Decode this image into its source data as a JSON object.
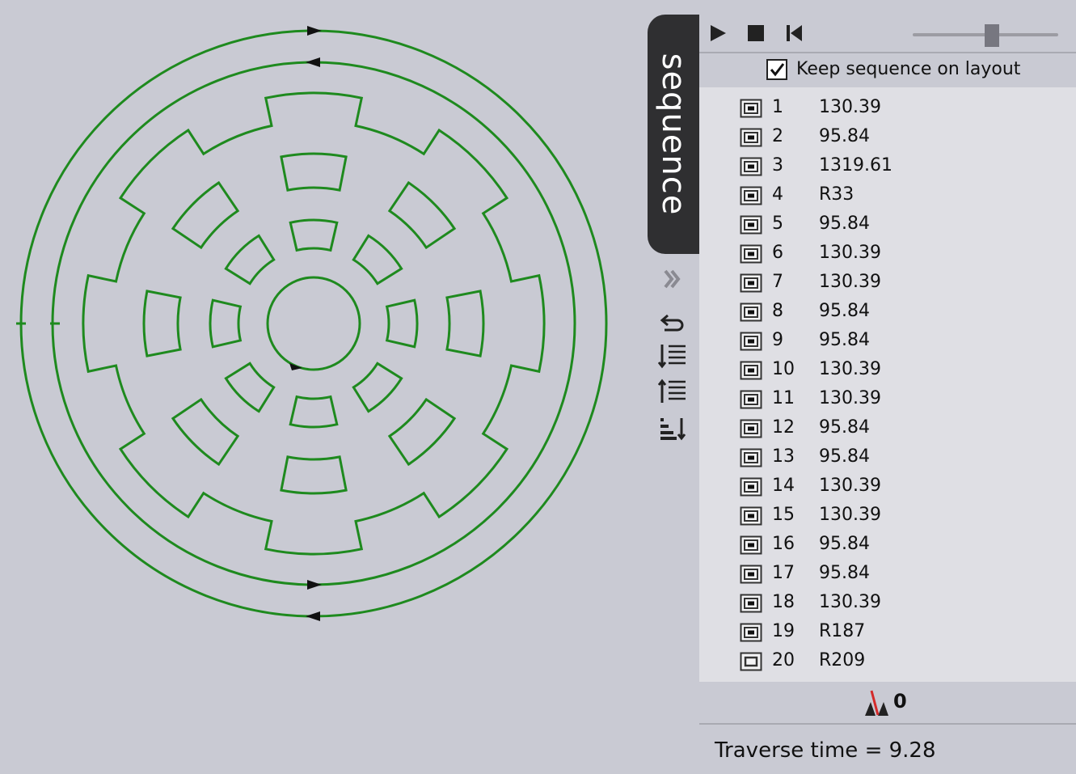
{
  "panel": {
    "tab_label": "sequence",
    "keep_sequence_label": "Keep sequence on layout",
    "keep_sequence_checked": true,
    "speed_level": 0.5,
    "items": [
      {
        "index": "1",
        "value": "130.39"
      },
      {
        "index": "2",
        "value": "95.84"
      },
      {
        "index": "3",
        "value": "1319.61"
      },
      {
        "index": "4",
        "value": "R33"
      },
      {
        "index": "5",
        "value": "95.84"
      },
      {
        "index": "6",
        "value": "130.39"
      },
      {
        "index": "7",
        "value": "130.39"
      },
      {
        "index": "8",
        "value": "95.84"
      },
      {
        "index": "9",
        "value": "95.84"
      },
      {
        "index": "10",
        "value": "130.39"
      },
      {
        "index": "11",
        "value": "130.39"
      },
      {
        "index": "12",
        "value": "95.84"
      },
      {
        "index": "13",
        "value": "95.84"
      },
      {
        "index": "14",
        "value": "130.39"
      },
      {
        "index": "15",
        "value": "130.39"
      },
      {
        "index": "16",
        "value": "95.84"
      },
      {
        "index": "17",
        "value": "95.84"
      },
      {
        "index": "18",
        "value": "130.39"
      },
      {
        "index": "19",
        "value": "R187"
      },
      {
        "index": "20",
        "value": "R209"
      }
    ],
    "indicator_value": "0",
    "traverse_text": "Traverse time = 9.28"
  },
  "icons": {
    "play": "play-icon",
    "stop": "stop-icon",
    "rewind": "skip-to-start-icon",
    "collapse": "double-chevron-right-icon",
    "undo": "undo-icon",
    "sort_down": "sort-down-icon",
    "sort_up": "sort-up-icon",
    "sort_bars": "sort-bars-icon",
    "indicator": "tool-indicator-icon",
    "item": "sequence-item-icon"
  },
  "colors": {
    "path": "#1e8a1e",
    "tab_bg": "#2f2f31",
    "background": "#c9cad3",
    "list_bg": "#dfdfe4"
  }
}
